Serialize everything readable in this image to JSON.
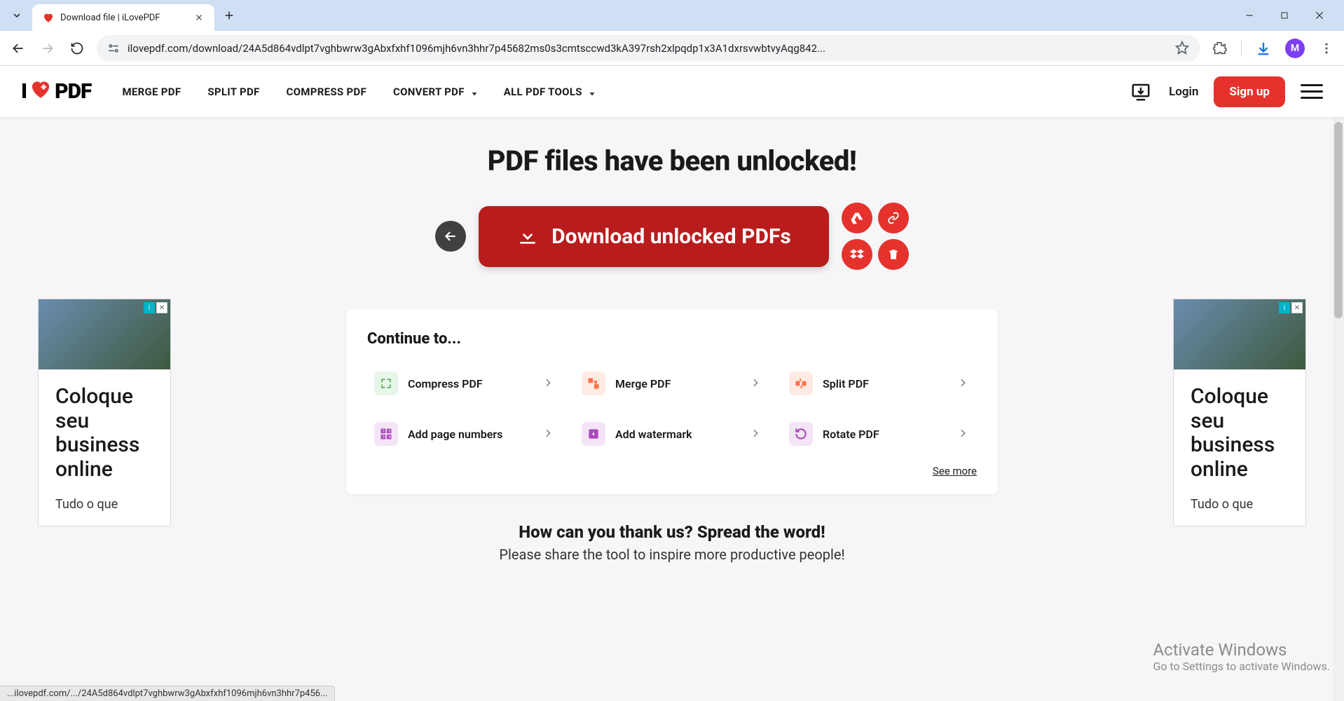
{
  "browser": {
    "tab_title": "Download file | iLovePDF",
    "url": "ilovepdf.com/download/24A5d864vdlpt7vghbwrw3gAbxfxhf1096mjh6vn3hhr7p45682ms0s3cmtsccwd3kA397rsh2xlpqdp1x3A1dxrsvwbtvyAqg842...",
    "avatar_initial": "M"
  },
  "colors": {
    "brand_red": "#e5322d",
    "dark_red": "#b91c1c"
  },
  "nav": {
    "items": [
      {
        "label": "MERGE PDF",
        "dropdown": false
      },
      {
        "label": "SPLIT PDF",
        "dropdown": false
      },
      {
        "label": "COMPRESS PDF",
        "dropdown": false
      },
      {
        "label": "CONVERT PDF",
        "dropdown": true
      },
      {
        "label": "ALL PDF TOOLS",
        "dropdown": true
      }
    ],
    "login": "Login",
    "signup": "Sign up"
  },
  "hero": {
    "title": "PDF files have been unlocked!",
    "download_label": "Download unlocked PDFs",
    "side_icons": [
      "google-drive-icon",
      "link-icon",
      "dropbox-icon",
      "trash-icon"
    ]
  },
  "continue": {
    "title": "Continue to...",
    "tools": [
      {
        "label": "Compress PDF",
        "icon": "compress-icon",
        "color": "#4caf50"
      },
      {
        "label": "Merge PDF",
        "icon": "merge-icon",
        "color": "#ff7043"
      },
      {
        "label": "Split PDF",
        "icon": "split-icon",
        "color": "#ff7043"
      },
      {
        "label": "Add page numbers",
        "icon": "page-numbers-icon",
        "color": "#ab47bc"
      },
      {
        "label": "Add watermark",
        "icon": "watermark-icon",
        "color": "#ab47bc"
      },
      {
        "label": "Rotate PDF",
        "icon": "rotate-icon",
        "color": "#ab47bc"
      }
    ],
    "see_more": "See more"
  },
  "ads": {
    "headline": "Coloque seu business online",
    "subline": "Tudo o que"
  },
  "thank": {
    "title": "How can you thank us? Spread the word!",
    "sub": "Please share the tool to inspire more productive people!"
  },
  "watermark": {
    "line1": "Activate Windows",
    "line2": "Go to Settings to activate Windows."
  },
  "status_bar": "...ilovepdf.com/.../24A5d864vdlpt7vghbwrw3gAbxfxhf1096mjh6vn3hhr7p456...",
  "logo_text_before": "I",
  "logo_text_after": "PDF"
}
